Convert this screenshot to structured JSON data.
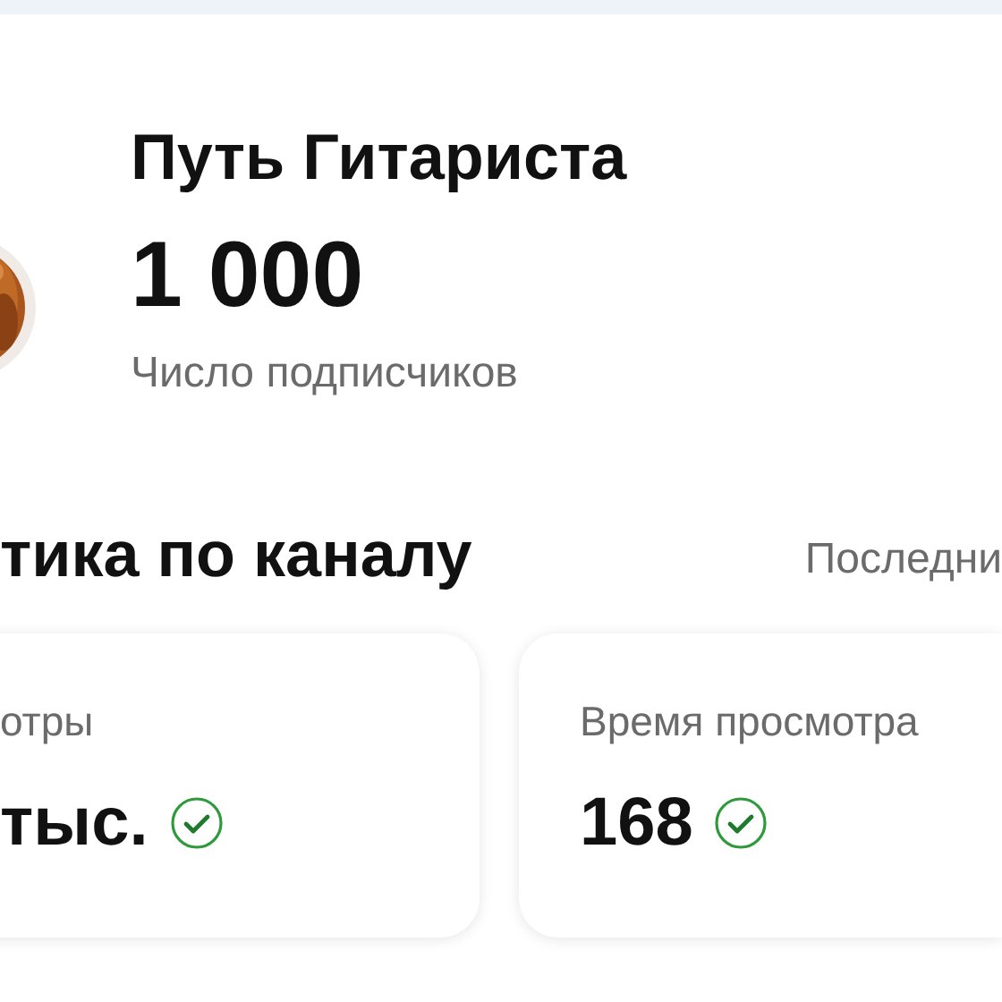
{
  "channel": {
    "name": "Путь Гитариста",
    "subscribers": "1 000",
    "subscribers_label": "Число подписчиков"
  },
  "section": {
    "title": "тика по каналу",
    "period": "Последни"
  },
  "cards": [
    {
      "label": "отры",
      "value": "тыс.",
      "verified": true
    },
    {
      "label": "Время просмотра",
      "value": "168",
      "verified": true
    }
  ]
}
